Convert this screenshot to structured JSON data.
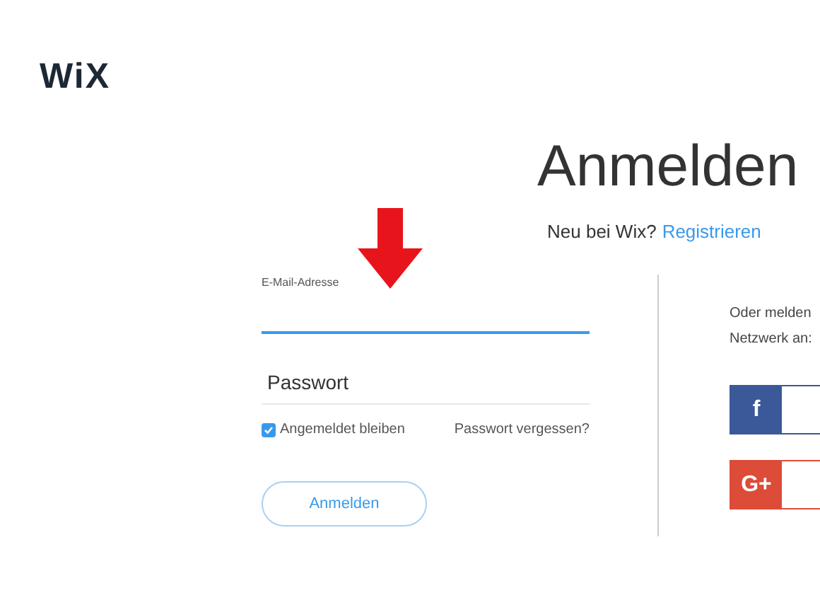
{
  "logo": "WiX",
  "title": "Anmelden",
  "signup": {
    "prompt": "Neu bei Wix?",
    "link": "Registrieren"
  },
  "form": {
    "email_label": "E-Mail-Adresse",
    "password": {
      "placeholder": "Passwort"
    },
    "remember": {
      "label": "Angemeldet bleiben",
      "checked": true
    },
    "forgot": "Passwort vergessen?",
    "submit": "Anmelden"
  },
  "social": {
    "lines": [
      "Oder melden",
      "Netzwerk an:"
    ],
    "buttons": [
      {
        "kind": "facebook",
        "icon": "f"
      },
      {
        "kind": "google",
        "icon": "G+"
      }
    ]
  }
}
